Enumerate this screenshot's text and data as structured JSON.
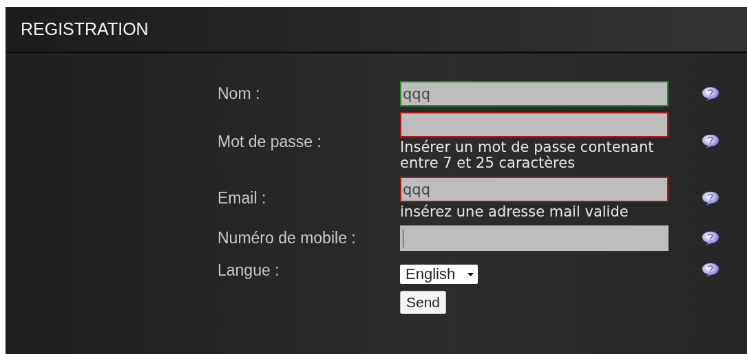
{
  "header": {
    "title": "REGISTRATION"
  },
  "fields": [
    {
      "label": "Nom :",
      "kind": "text",
      "value": "qqq",
      "valid": true,
      "invalid": false
    },
    {
      "label": "Mot de passe :",
      "kind": "text",
      "valid": false,
      "invalid": true,
      "hint": "Insérer un mot de passe contenant entre 7 et 25 caractères"
    },
    {
      "label": "Email :",
      "kind": "text",
      "value": "qqq",
      "valid": false,
      "invalid": true,
      "hint": "insérez une adresse mail valide"
    },
    {
      "label": "Numéro de mobile :",
      "kind": "text",
      "valid": false,
      "invalid": false,
      "focused": true
    },
    {
      "label": "Langue :",
      "kind": "select",
      "value": "English"
    }
  ],
  "submit": {
    "label": "Send"
  }
}
